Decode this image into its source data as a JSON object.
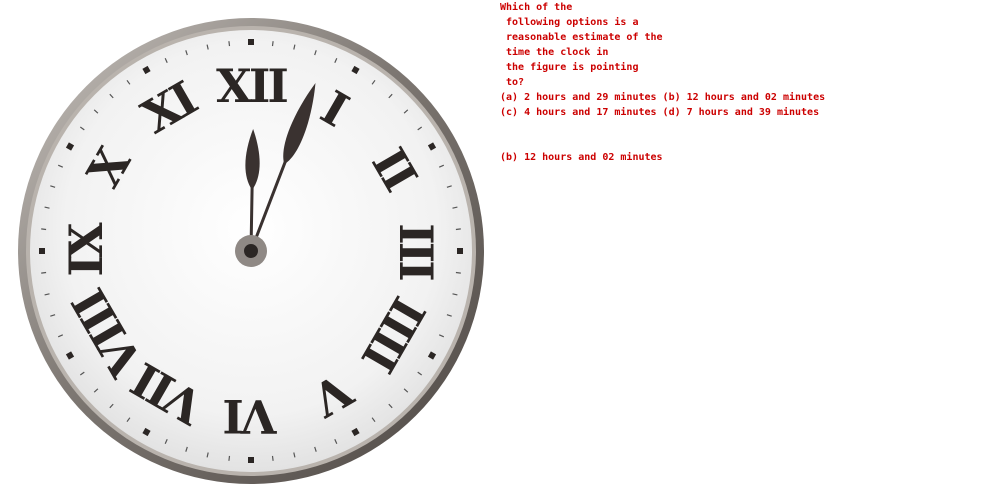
{
  "question": {
    "lines": [
      "Which of the",
      " following options is a",
      " reasonable estimate of the",
      " time the clock in",
      " the figure is pointing",
      " to?"
    ],
    "options": [
      "(a) 2 hours and 29 minutes (b) 12 hours and 02 minutes",
      "(c) 4 hours and 17 minutes (d) 7 hours and 39 minutes"
    ]
  },
  "answer": "(b) 12 hours and 02 minutes",
  "clock": {
    "numerals": [
      "XII",
      "I",
      "II",
      "III",
      "IIII",
      "V",
      "VI",
      "VII",
      "VIII",
      "IX",
      "X",
      "XI"
    ],
    "hour": 12,
    "minute": 2,
    "colors": {
      "text": "#cc0000",
      "numerals": "#2b2624",
      "hands": "#3a3230",
      "face": "#f3f3f3",
      "rim": "#8a8480"
    }
  }
}
